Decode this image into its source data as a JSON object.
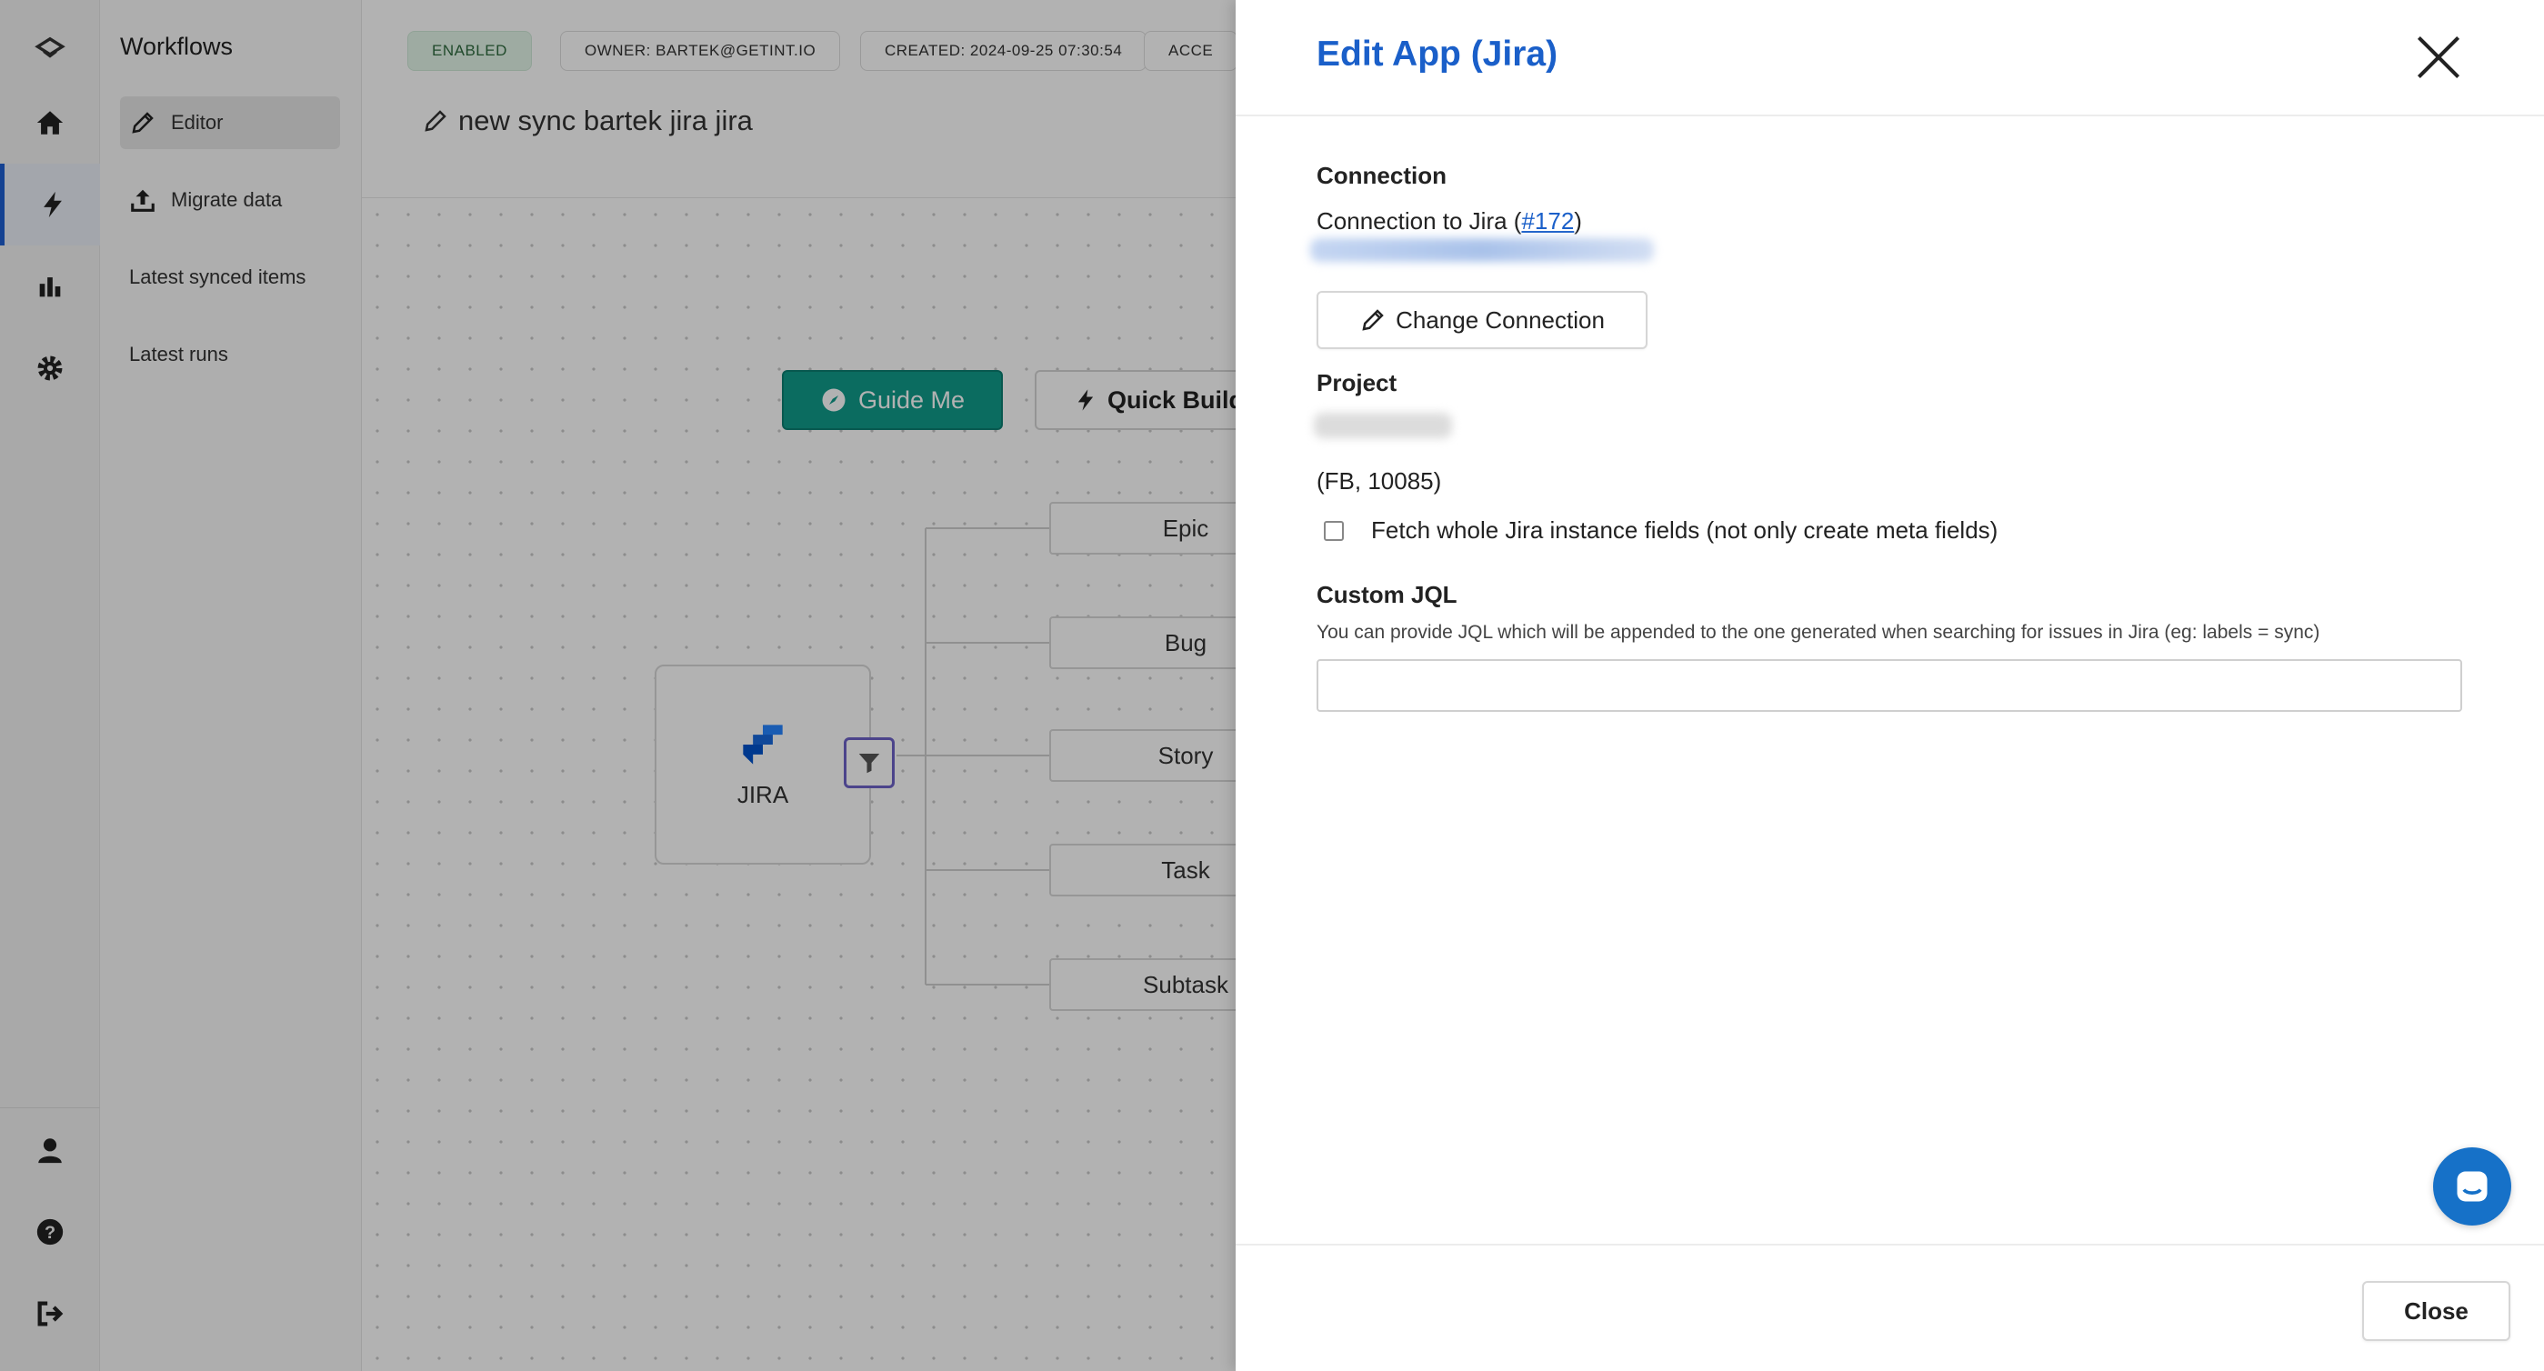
{
  "app": {
    "rail": {
      "items": [
        "logo-icon",
        "home-icon",
        "bolt-icon",
        "bar-chart-icon",
        "gear-icon",
        "user-icon",
        "help-icon",
        "logout-icon"
      ]
    },
    "subnav": {
      "title": "Workflows",
      "items": [
        {
          "label": "Editor",
          "icon": "pencil-icon",
          "active": true
        },
        {
          "label": "Migrate data",
          "icon": "upload-icon"
        },
        {
          "label": "Latest synced items"
        },
        {
          "label": "Latest runs"
        }
      ]
    },
    "topbar": {
      "badges": [
        "ENABLED",
        "OWNER: BARTEK@GETINT.IO",
        "CREATED: 2024-09-25 07:30:54",
        "ACCE"
      ],
      "sync_name": "new sync bartek jira jira"
    },
    "canvas": {
      "guide_button": "Guide Me",
      "quick_button": "Quick Build",
      "app_node_label": "JIRA",
      "issue_types": [
        "Epic",
        "Bug",
        "Story",
        "Task",
        "Subtask"
      ]
    }
  },
  "drawer": {
    "title": "Edit App (Jira)",
    "connection": {
      "label": "Connection",
      "text_prefix": "Connection to Jira (",
      "link": "#172",
      "text_suffix": ")",
      "change_button": "Change Connection"
    },
    "project": {
      "label": "Project",
      "key_info": "(FB, 10085)"
    },
    "fetch_checkbox": {
      "label": "Fetch whole Jira instance fields (not only create meta fields)",
      "checked": false
    },
    "custom_jql": {
      "label": "Custom JQL",
      "hint": "You can provide JQL which will be appended to the one generated when searching for issues in Jira (eg: labels = sync)",
      "value": "",
      "placeholder": ""
    },
    "close_button": "Close"
  },
  "colors": {
    "accent": "#1a5fc9",
    "guide_green": "#119b8a",
    "filter_purple": "#6d62c8",
    "chat_blue": "#1671c8"
  }
}
